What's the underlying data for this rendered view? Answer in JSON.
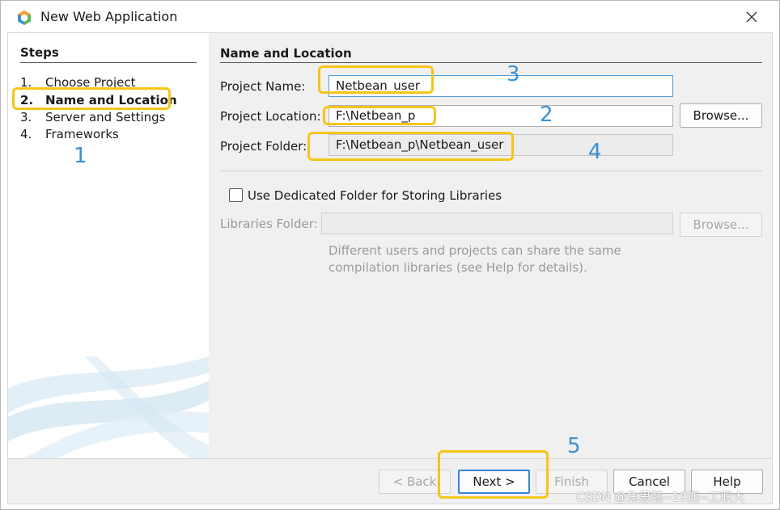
{
  "window": {
    "title": "New Web Application",
    "icon": "netbeans-cube-icon"
  },
  "steps": {
    "header": "Steps",
    "items": [
      {
        "num": "1.",
        "label": "Choose Project",
        "current": false
      },
      {
        "num": "2.",
        "label": "Name and Location",
        "current": true
      },
      {
        "num": "3.",
        "label": "Server and Settings",
        "current": false
      },
      {
        "num": "4.",
        "label": "Frameworks",
        "current": false
      }
    ]
  },
  "main": {
    "section_title": "Name and Location",
    "project_name_label": "Project Name:",
    "project_name_value": "Netbean_user",
    "project_location_label": "Project Location:",
    "project_location_value": "F:\\Netbean_p",
    "browse_label": "Browse...",
    "project_folder_label": "Project Folder:",
    "project_folder_value": "F:\\Netbean_p\\Netbean_user",
    "dedicated_folder_label": "Use Dedicated Folder for Storing Libraries",
    "dedicated_folder_checked": false,
    "libraries_folder_label": "Libraries Folder:",
    "libraries_folder_value": "",
    "libraries_browse_label": "Browse...",
    "hint_text": "Different users and projects can share the same compilation libraries (see Help for details)."
  },
  "footer": {
    "back_label": "< Back",
    "next_label": "Next >",
    "finish_label": "Finish",
    "cancel_label": "Cancel",
    "help_label": "Help"
  },
  "annotations": [
    "1",
    "2",
    "3",
    "4",
    "5"
  ],
  "watermark": "CSDN @焦思懿--19期--工职大",
  "colors": {
    "highlight": "#f5c518",
    "annotation": "#3b8fd6",
    "focus_border": "#4d9ee0",
    "default_button_border": "#3b82d6"
  }
}
